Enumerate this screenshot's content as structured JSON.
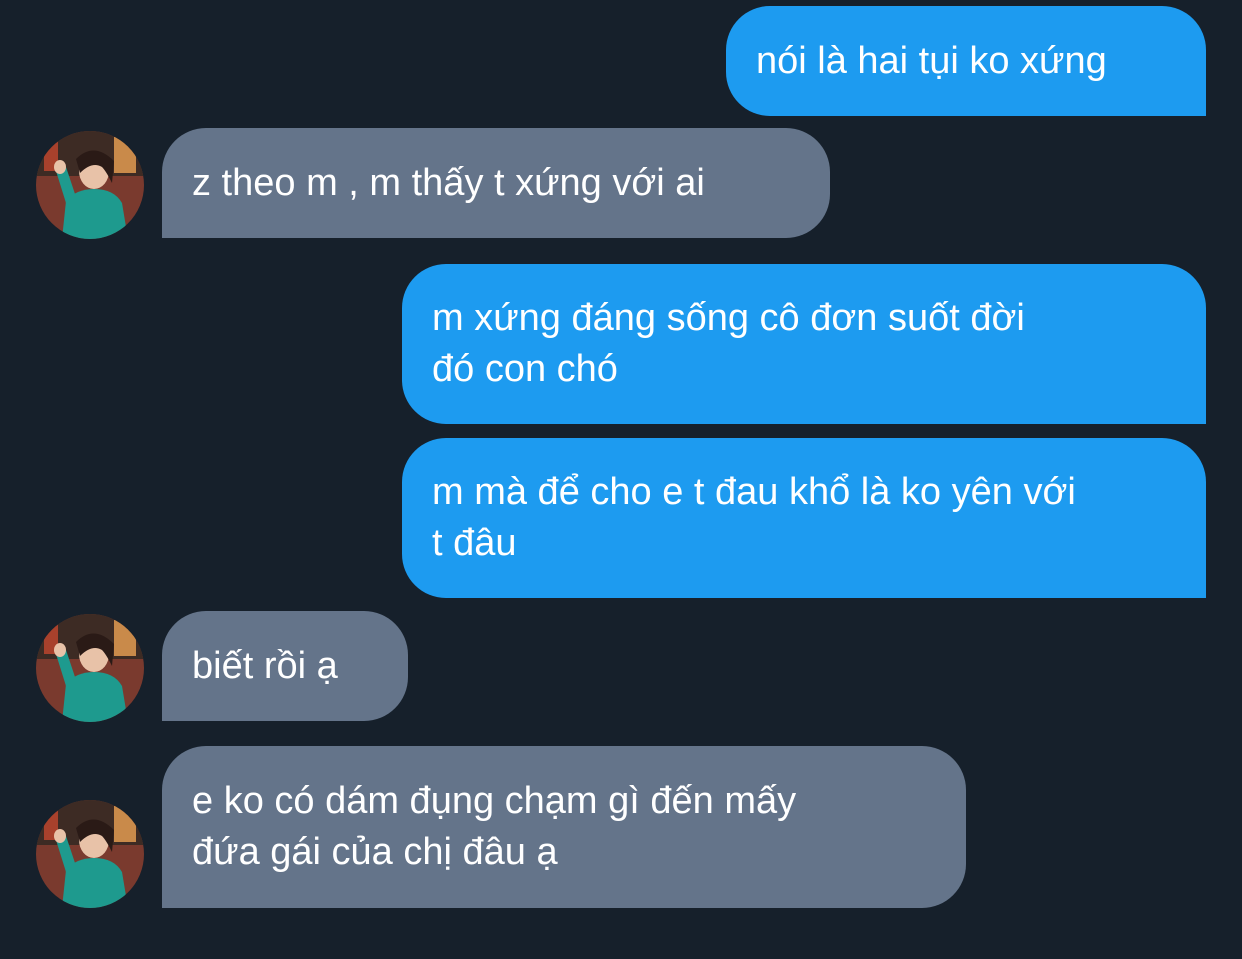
{
  "conversation": {
    "messages": [
      {
        "sender": "me",
        "text": "nói là hai tụi ko xứng"
      },
      {
        "sender": "them",
        "text": "z theo m , m thấy t xứng với ai"
      },
      {
        "sender": "me",
        "text": "m xứng đáng sống cô đơn suốt đời\nđó con chó"
      },
      {
        "sender": "me",
        "text": "m mà để cho e t đau khổ là ko yên với\nt đâu"
      },
      {
        "sender": "them",
        "text": "biết rồi ạ"
      },
      {
        "sender": "them",
        "text": "e ko có dám đụng chạm gì đến mấy\nđứa gái của chị đâu ạ"
      }
    ]
  },
  "colors": {
    "background": "#16202b",
    "outgoing_bubble": "#1d9bf0",
    "incoming_bubble": "#64748a",
    "text": "#ffffff"
  },
  "icons": {
    "avatar": "contact-avatar-photo"
  }
}
